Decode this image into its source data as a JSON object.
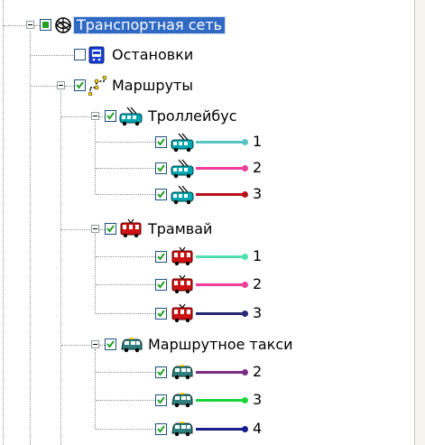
{
  "tree": {
    "root": {
      "label": "Транспортная сеть"
    },
    "stops": {
      "label": "Остановки"
    },
    "routes": {
      "label": "Маршруты"
    },
    "trolleybus": {
      "label": "Троллейбус",
      "items": [
        {
          "label": "1",
          "color": "#59c3c3"
        },
        {
          "label": "2",
          "color": "#ee3d9a"
        },
        {
          "label": "3",
          "color": "#b5121b"
        }
      ]
    },
    "tram": {
      "label": "Трамвай",
      "items": [
        {
          "label": "1",
          "color": "#52e0b0"
        },
        {
          "label": "2",
          "color": "#ee3d9a"
        },
        {
          "label": "3",
          "color": "#262873"
        }
      ]
    },
    "taxi": {
      "label": "Маршрутное такси",
      "items": [
        {
          "label": "2",
          "color": "#7b2c82"
        },
        {
          "label": "3",
          "color": "#18d63a"
        },
        {
          "label": "4",
          "color": "#171b8c"
        }
      ]
    }
  },
  "colors": {
    "selection": "#316ac5",
    "checkmark": "#21a121",
    "trolleybus_icon": "#00a6b0",
    "tram_icon": "#cc1212",
    "taxi_icon": "#2e7f7d"
  },
  "icons": {
    "root": "network-icon",
    "stops": "bus-stop-icon",
    "routes": "route-icon",
    "trolleybus": "trolleybus-icon",
    "tram": "tram-icon",
    "taxi": "minibus-icon"
  }
}
